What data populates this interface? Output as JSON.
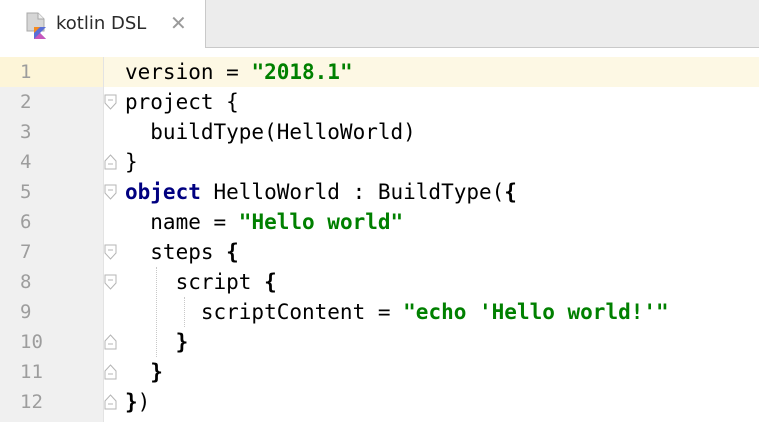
{
  "tab": {
    "label": "kotlin DSL",
    "close": "✕"
  },
  "lines": [
    {
      "num": "1",
      "parts": [
        [
          "version = ",
          ""
        ],
        [
          "\"2018.1\"",
          "str"
        ]
      ]
    },
    {
      "num": "2",
      "parts": [
        [
          "project ",
          ""
        ],
        [
          "{",
          ""
        ]
      ]
    },
    {
      "num": "3",
      "parts": [
        [
          "  buildType(HelloWorld)",
          ""
        ]
      ]
    },
    {
      "num": "4",
      "parts": [
        [
          "}",
          ""
        ]
      ]
    },
    {
      "num": "5",
      "parts": [
        [
          "object",
          "kw"
        ],
        [
          " HelloWorld : BuildType(",
          ""
        ],
        [
          "{",
          "br"
        ]
      ]
    },
    {
      "num": "6",
      "parts": [
        [
          "  name = ",
          ""
        ],
        [
          "\"Hello world\"",
          "str"
        ]
      ]
    },
    {
      "num": "7",
      "parts": [
        [
          "  steps ",
          ""
        ],
        [
          "{",
          "br"
        ]
      ]
    },
    {
      "num": "8",
      "parts": [
        [
          "    script ",
          ""
        ],
        [
          "{",
          "br"
        ]
      ]
    },
    {
      "num": "9",
      "parts": [
        [
          "      scriptContent = ",
          ""
        ],
        [
          "\"echo 'Hello world!'\"",
          "str"
        ]
      ]
    },
    {
      "num": "10",
      "parts": [
        [
          "    ",
          ""
        ],
        [
          "}",
          "br"
        ]
      ]
    },
    {
      "num": "11",
      "parts": [
        [
          "  ",
          ""
        ],
        [
          "}",
          "br"
        ]
      ]
    },
    {
      "num": "12",
      "parts": [
        [
          "}",
          "br"
        ],
        [
          ")",
          ""
        ]
      ]
    }
  ],
  "fold_markers": [
    {
      "line": 2,
      "dir": "open"
    },
    {
      "line": 4,
      "dir": "close"
    },
    {
      "line": 5,
      "dir": "open"
    },
    {
      "line": 7,
      "dir": "open"
    },
    {
      "line": 8,
      "dir": "open"
    },
    {
      "line": 10,
      "dir": "close"
    },
    {
      "line": 11,
      "dir": "close"
    },
    {
      "line": 12,
      "dir": "close"
    }
  ],
  "current_line": 1,
  "colors": {
    "keyword": "#000080",
    "string": "#008000",
    "line_number": "#9d9d9d",
    "current_line": "#fdf8e4",
    "gutter": "#f0f0f0"
  }
}
